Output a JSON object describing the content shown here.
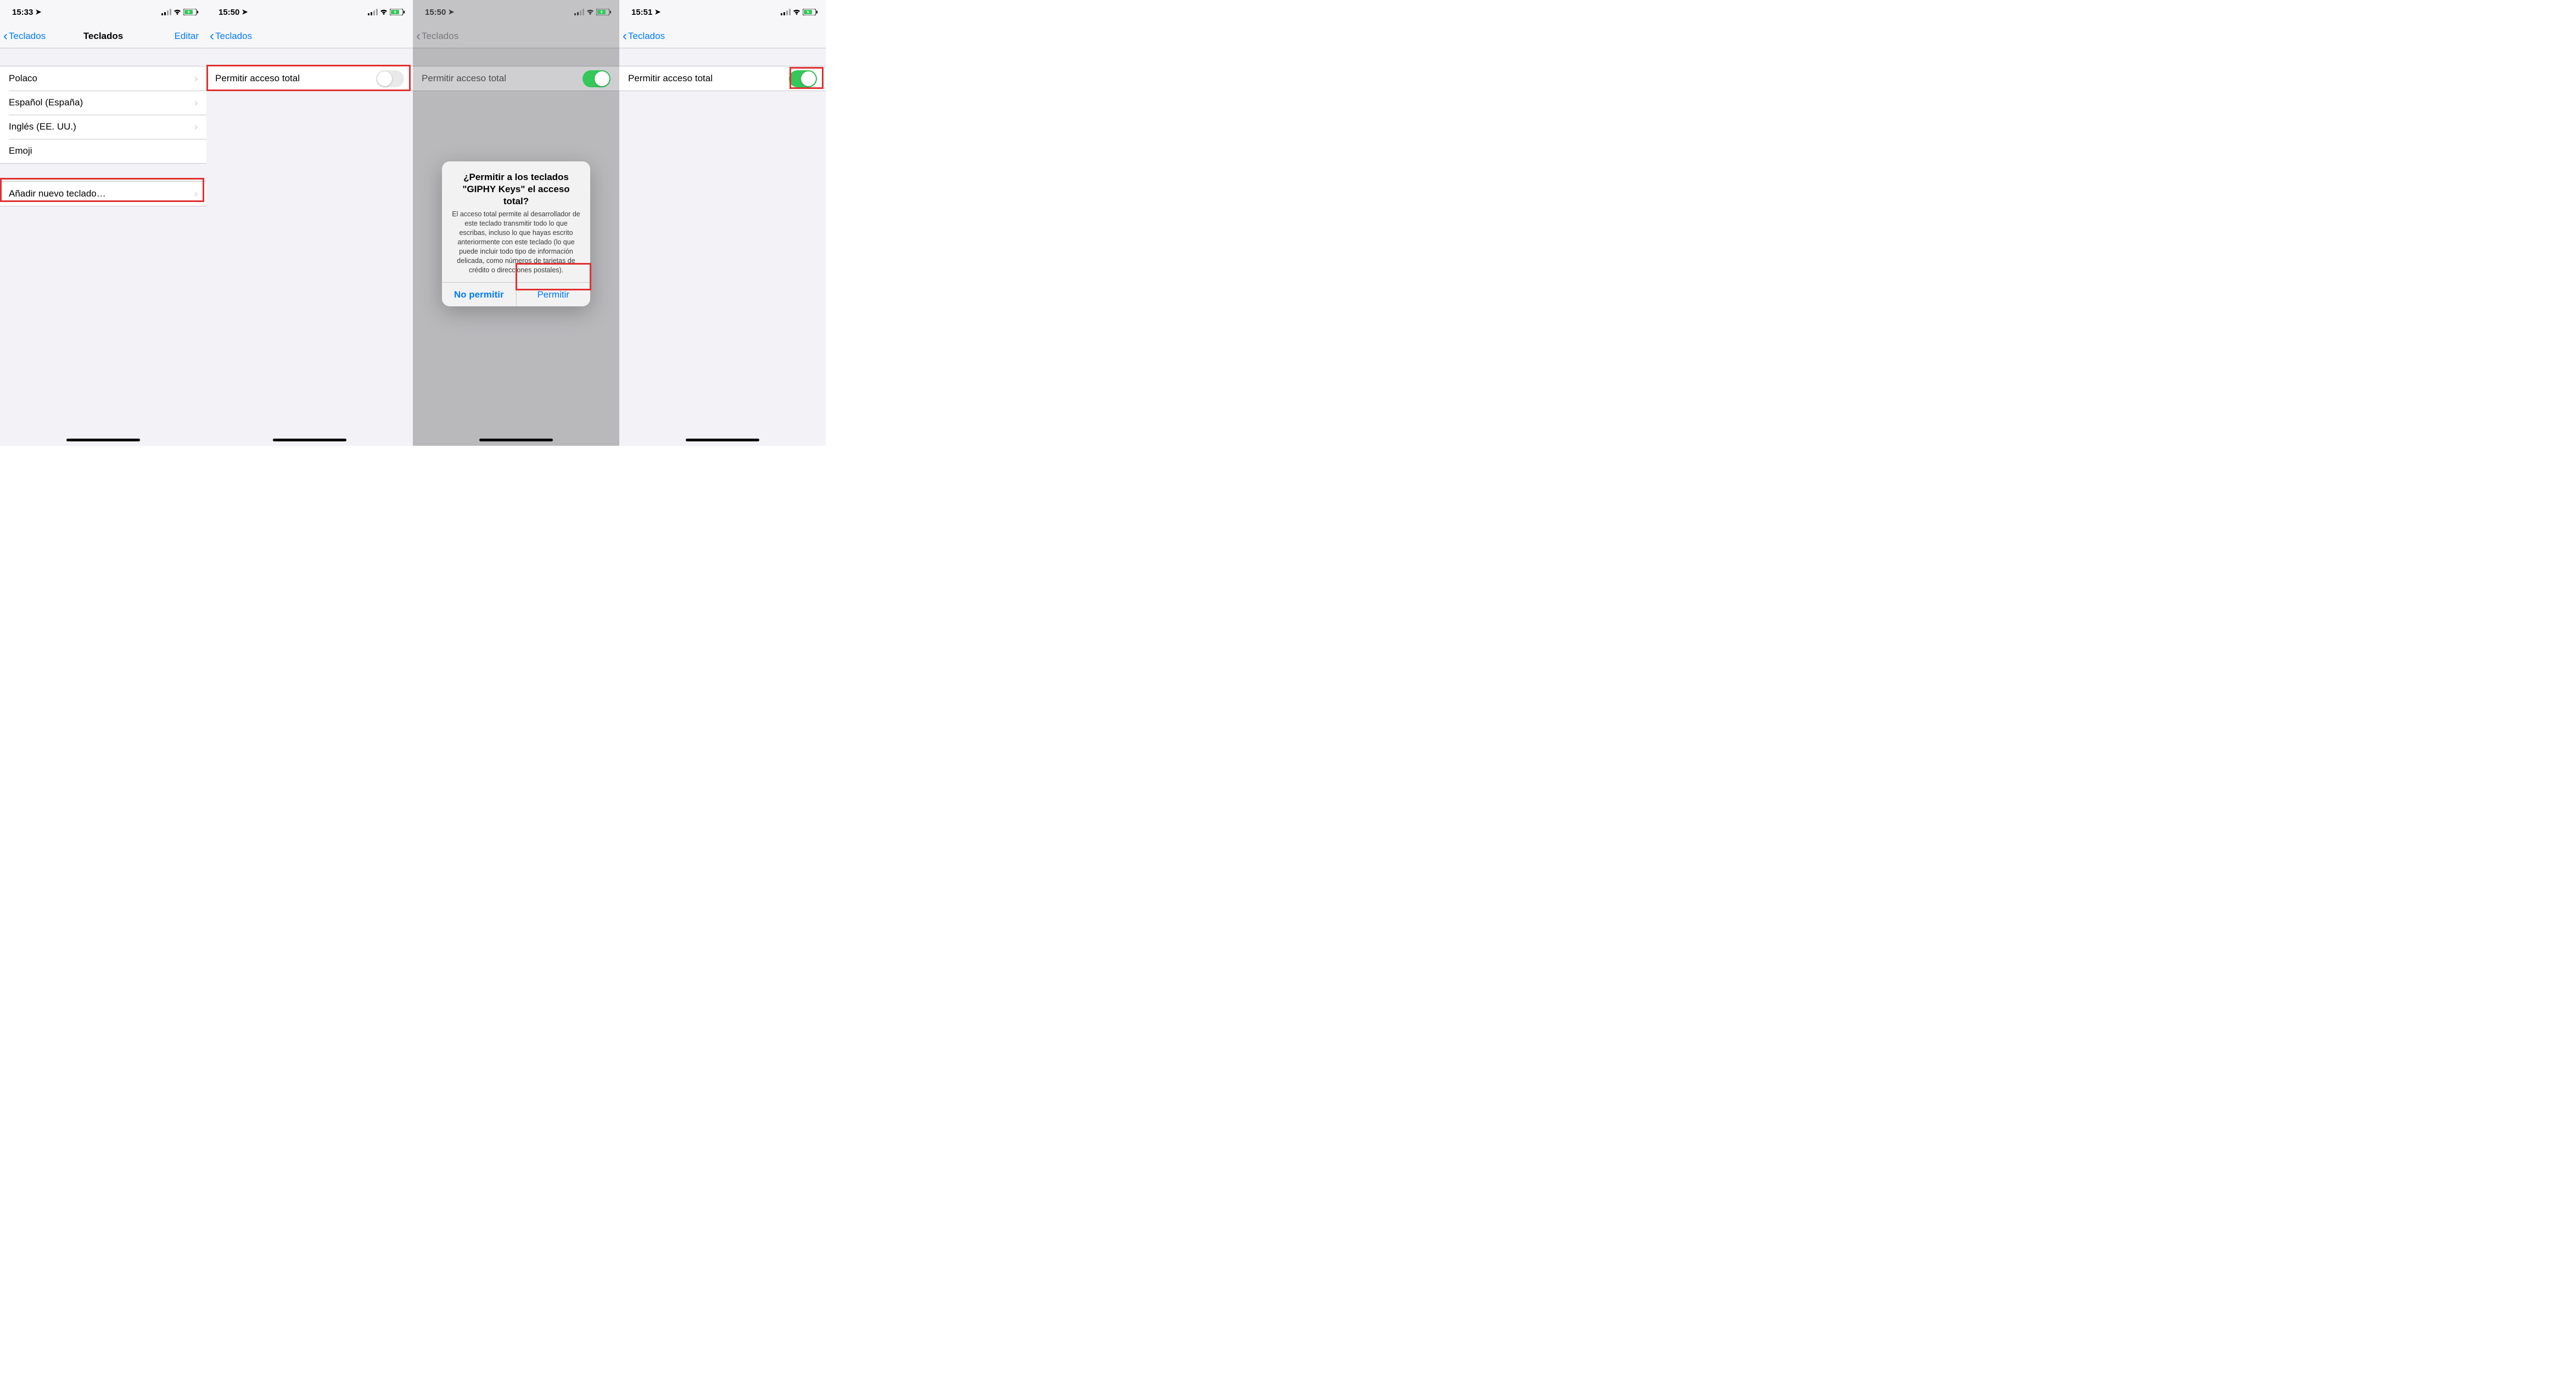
{
  "screens": [
    {
      "time": "15:33",
      "back": "Teclados",
      "title": "Teclados",
      "edit": "Editar",
      "keyboards": [
        "Polaco",
        "Español (España)",
        "Inglés (EE. UU.)",
        "Emoji"
      ],
      "add": "Añadir nuevo teclado…"
    },
    {
      "time": "15:50",
      "back": "Teclados",
      "toggle_label": "Permitir acceso total",
      "toggle_on": false
    },
    {
      "time": "15:50",
      "back": "Teclados",
      "toggle_label": "Permitir acceso total",
      "toggle_on": true,
      "alert": {
        "title": "¿Permitir a los teclados \"GIPHY Keys\" el acceso total?",
        "message": "El acceso total permite al desarrollador de este teclado transmitir todo lo que escribas, incluso lo que hayas escrito anteriormente con este teclado (lo que puede incluir todo tipo de información delicada, como números de tarjetas de crédito o direcciones postales).",
        "deny": "No permitir",
        "allow": "Permitir"
      }
    },
    {
      "time": "15:51",
      "back": "Teclados",
      "toggle_label": "Permitir acceso total",
      "toggle_on": true
    }
  ]
}
